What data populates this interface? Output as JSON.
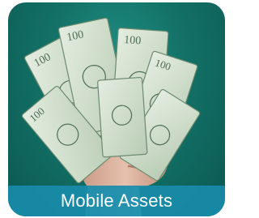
{
  "tile": {
    "caption": "Mobile Assets",
    "image_icon": "hand-holding-cash-icon"
  },
  "colors": {
    "background": "#137167",
    "caption_bar": "#188caa",
    "caption_text": "#ffffff",
    "banknote": "#d7e3cf",
    "banknote_ink": "#4f6e55"
  }
}
